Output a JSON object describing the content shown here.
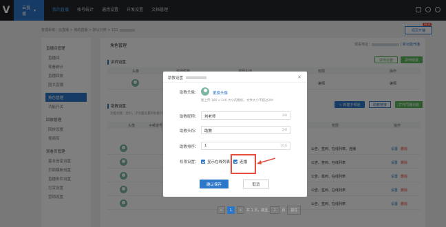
{
  "topbar": {
    "logo": "V",
    "product": "云直播",
    "nav": [
      "我的直播",
      "帐号统计",
      "通用设置",
      "开发设置",
      "文档管理"
    ]
  },
  "breadcrumb": "管理系统：云直播 > 我的直播 > 默认分类 > 111",
  "new_button": "网页开播",
  "new_tag": "NEW",
  "sidebar": {
    "groups": [
      {
        "title": "直播间管理",
        "items": [
          "直播间",
          "观看统计",
          "直播回放",
          "图文直播"
        ]
      },
      {
        "title": "",
        "items": [
          "角色管理",
          "功能开关"
        ]
      },
      {
        "title": "回放管理",
        "items": [
          "回放设置",
          "视频库"
        ]
      },
      {
        "title": "观看页管理",
        "items": [
          "基本信息设置",
          "页面模板设置",
          "直播条件设置",
          "打赏设置",
          "营销设置"
        ]
      }
    ],
    "active": "角色管理"
  },
  "main": {
    "title": "角色管理",
    "right_label": "观看地址：",
    "right_link": "新功能开播",
    "section1": "讲师设置",
    "btn_lecturer_settings": "讲师设置",
    "btn_lecturer_link": "讲师链接",
    "t1_headers": [
      "头像",
      "讲师昵称",
      "讲师头衔",
      "权限",
      "操作"
    ],
    "t1_row": {
      "perm": "讲师",
      "action": "讲师"
    },
    "section2": "助教设置",
    "section2_desc": "功能功能：您好，子页面设置的助教只能在手机端使用，助教可以回复观众问题",
    "btn_new": "+ 新建子频道",
    "btn_assistant_link": "助教链接",
    "btn_open": "打开同播功能",
    "t2_headers": [
      "头像",
      "子频道号",
      "",
      "权限",
      "操作"
    ],
    "t2_rows": [
      {
        "perm": "公告、签到、在线列表、连播",
        "edit": "设置",
        "del": "删除"
      },
      {
        "perm": "公告、签到、在线列表",
        "edit": "设置",
        "del": "删除"
      },
      {
        "perm": "公告、签到、在线列表",
        "edit": "设置",
        "del": "删除"
      },
      {
        "perm": "公告、签到、在线列表",
        "edit": "设置",
        "del": "删除"
      },
      {
        "perm": "公告、签到、在线列表",
        "edit": "设置",
        "del": "删除"
      }
    ]
  },
  "pager": {
    "pages": [
      "<",
      "1",
      ">"
    ],
    "total": "共 1 页，跳至",
    "page_input": "1",
    "unit": "页",
    "go": "前往"
  },
  "modal": {
    "title": "助教设置",
    "avatar_label": "助教头像：",
    "change_avatar": "更换头像",
    "avatar_hint": "图上传 180 x 140 大小的图标，文件大小不超过2M",
    "nickname_label": "助教昵称：",
    "nickname_value": "刘老师",
    "nickname_count": "3/8",
    "title_label": "助教头衔：",
    "title_value": "助教",
    "title_count": "2/8",
    "order_label": "助教排序：",
    "order_value": "1",
    "order_count": "1/16",
    "perm_label": "权限设置：",
    "perm1": "显示在线列表",
    "perm2": "连播",
    "ok": "确认保存",
    "cancel": "取消"
  },
  "colors": {
    "accent": "#2d77c8",
    "highlight": "#e74c3c",
    "green": "#5cb85c"
  }
}
